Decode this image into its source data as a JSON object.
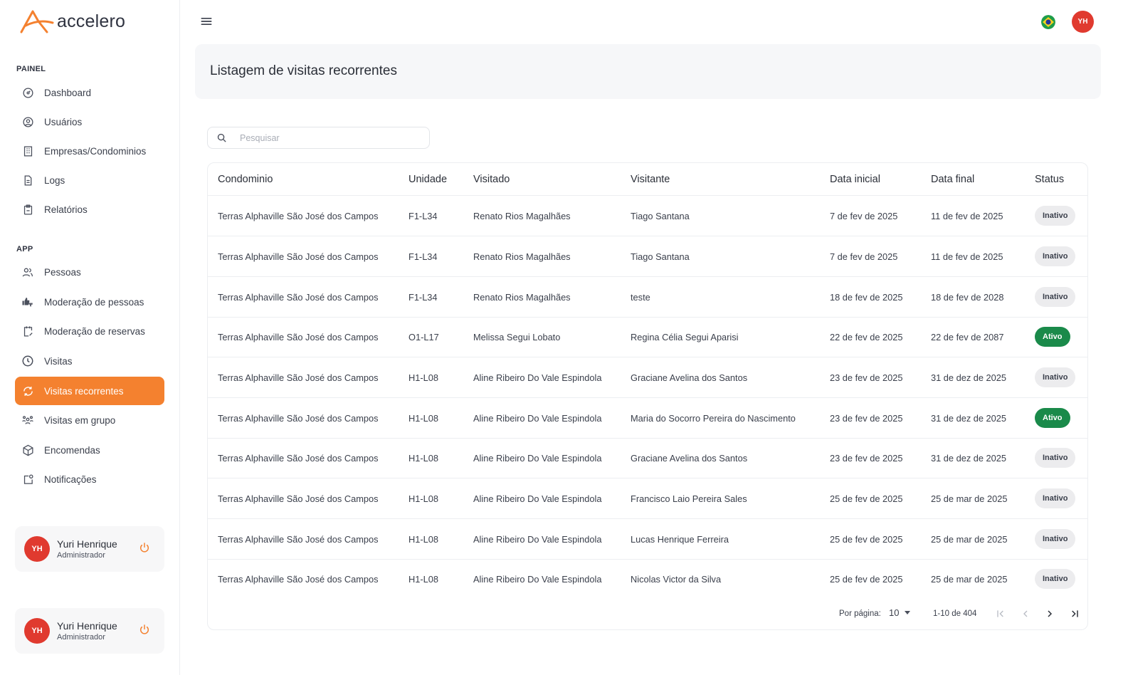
{
  "brand": {
    "name": "accelero",
    "accent": "#f4812f"
  },
  "sidebar": {
    "sections": [
      {
        "title": "PAINEL"
      },
      {
        "title": "APP"
      }
    ],
    "painel_items": [
      {
        "label": "Dashboard",
        "icon": "dashboard-icon"
      },
      {
        "label": "Usuários",
        "icon": "user-circle-icon"
      },
      {
        "label": "Empresas/Condominios",
        "icon": "building-icon"
      },
      {
        "label": "Logs",
        "icon": "file-icon"
      },
      {
        "label": "Relatórios",
        "icon": "clipboard-icon"
      }
    ],
    "app_items": [
      {
        "label": "Pessoas",
        "icon": "people-icon"
      },
      {
        "label": "Moderação de pessoas",
        "icon": "thumbs-icon"
      },
      {
        "label": "Moderação de reservas",
        "icon": "calendar-edit-icon"
      },
      {
        "label": "Visitas",
        "icon": "clock-icon"
      },
      {
        "label": "Visitas recorrentes",
        "icon": "refresh-icon",
        "active": true
      },
      {
        "label": "Visitas em grupo",
        "icon": "group-icon"
      },
      {
        "label": "Encomendas",
        "icon": "package-icon"
      },
      {
        "label": "Notificações",
        "icon": "notification-icon"
      }
    ],
    "user_cards": [
      {
        "initials": "YH",
        "name": "Yuri Henrique",
        "role": "Administrador"
      },
      {
        "initials": "YH",
        "name": "Yuri Henrique",
        "role": "Administrador"
      }
    ]
  },
  "topbar": {
    "avatar_initials": "YH"
  },
  "page": {
    "title": "Listagem de visitas recorrentes"
  },
  "search": {
    "placeholder": "Pesquisar",
    "value": ""
  },
  "table": {
    "headers": [
      "Condominio",
      "Unidade",
      "Visitado",
      "Visitante",
      "Data inicial",
      "Data final",
      "Status"
    ],
    "rows": [
      [
        "Terras Alphaville São José dos Campos",
        "F1-L34",
        "Renato Rios Magalhães",
        "Tiago Santana",
        "7 de fev de 2025",
        "11 de fev de 2025",
        "Inativo"
      ],
      [
        "Terras Alphaville São José dos Campos",
        "F1-L34",
        "Renato Rios Magalhães",
        "Tiago Santana",
        "7 de fev de 2025",
        "11 de fev de 2025",
        "Inativo"
      ],
      [
        "Terras Alphaville São José dos Campos",
        "F1-L34",
        "Renato Rios Magalhães",
        "teste",
        "18 de fev de 2025",
        "18 de fev de 2028",
        "Inativo"
      ],
      [
        "Terras Alphaville São José dos Campos",
        "O1-L17",
        "Melissa Segui Lobato",
        "Regina Célia Segui Aparisi",
        "22 de fev de 2025",
        "22 de fev de 2087",
        "Ativo"
      ],
      [
        "Terras Alphaville São José dos Campos",
        "H1-L08",
        "Aline Ribeiro Do Vale Espindola",
        "Graciane Avelina dos Santos",
        "23 de fev de 2025",
        "31 de dez de 2025",
        "Inativo"
      ],
      [
        "Terras Alphaville São José dos Campos",
        "H1-L08",
        "Aline Ribeiro Do Vale Espindola",
        "Maria do Socorro Pereira do Nascimento",
        "23 de fev de 2025",
        "31 de dez de 2025",
        "Ativo"
      ],
      [
        "Terras Alphaville São José dos Campos",
        "H1-L08",
        "Aline Ribeiro Do Vale Espindola",
        "Graciane Avelina dos Santos",
        "23 de fev de 2025",
        "31 de dez de 2025",
        "Inativo"
      ],
      [
        "Terras Alphaville São José dos Campos",
        "H1-L08",
        "Aline Ribeiro Do Vale Espindola",
        "Francisco Laio Pereira Sales",
        "25 de fev de 2025",
        "25 de mar de 2025",
        "Inativo"
      ],
      [
        "Terras Alphaville São José dos Campos",
        "H1-L08",
        "Aline Ribeiro Do Vale Espindola",
        "Lucas Henrique Ferreira",
        "25 de fev de 2025",
        "25 de mar de 2025",
        "Inativo"
      ],
      [
        "Terras Alphaville São José dos Campos",
        "H1-L08",
        "Aline Ribeiro Do Vale Espindola",
        "Nicolas Victor da Silva",
        "25 de fev de 2025",
        "25 de mar de 2025",
        "Inativo"
      ]
    ]
  },
  "pagination": {
    "per_page_label": "Por página:",
    "per_page_value": "10",
    "range": "1-10 de 404"
  },
  "colors": {
    "active_badge": "#1a8a4a",
    "inactive_badge": "#ececee",
    "avatar": "#e03a2f"
  }
}
